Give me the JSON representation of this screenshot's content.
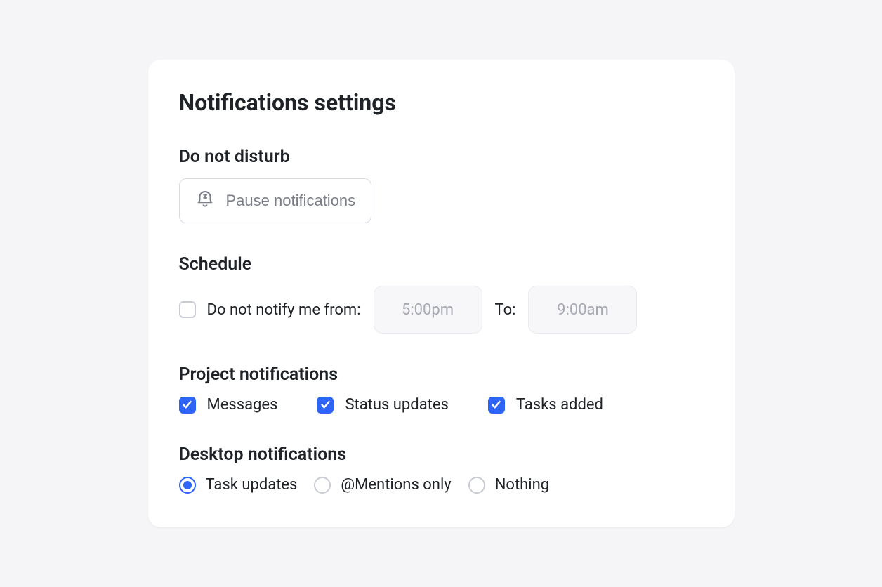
{
  "title": "Notifications settings",
  "sections": {
    "dnd": {
      "heading": "Do not disturb",
      "pause_label": "Pause notifications"
    },
    "schedule": {
      "heading": "Schedule",
      "checkbox_label": "Do not notify me from:",
      "checked": false,
      "from_time": "5:00pm",
      "to_label": "To:",
      "to_time": "9:00am"
    },
    "project": {
      "heading": "Project notifications",
      "options": [
        {
          "label": "Messages",
          "checked": true
        },
        {
          "label": "Status updates",
          "checked": true
        },
        {
          "label": "Tasks added",
          "checked": true
        }
      ]
    },
    "desktop": {
      "heading": "Desktop notifications",
      "options": [
        {
          "label": "Task updates",
          "selected": true
        },
        {
          "label": "@Mentions only",
          "selected": false
        },
        {
          "label": "Nothing",
          "selected": false
        }
      ]
    }
  }
}
